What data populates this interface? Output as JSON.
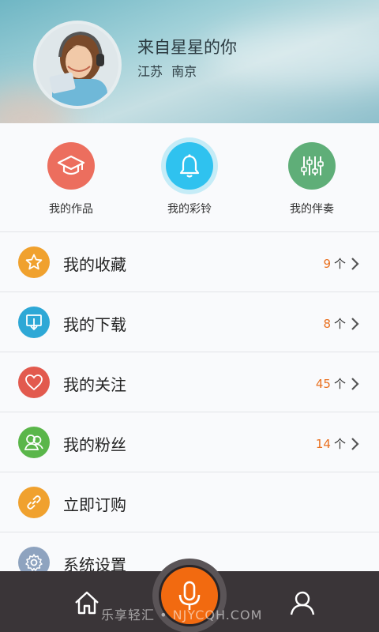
{
  "profile": {
    "nickname": "来自星星的你",
    "location": "江苏 南京"
  },
  "quick_actions": [
    {
      "label": "我的作品",
      "icon": "graduation-cap-icon",
      "color": "#ec6e5e"
    },
    {
      "label": "我的彩铃",
      "icon": "bell-icon",
      "color": "#2fc2ef"
    },
    {
      "label": "我的伴奏",
      "icon": "equalizer-icon",
      "color": "#5fae78"
    }
  ],
  "menu": [
    {
      "label": "我的收藏",
      "icon": "star-icon",
      "color": "#f0a12e",
      "count": "9",
      "unit": "个"
    },
    {
      "label": "我的下载",
      "icon": "download-icon",
      "color": "#2ea8d6",
      "count": "8",
      "unit": "个"
    },
    {
      "label": "我的关注",
      "icon": "heart-icon",
      "color": "#e25a4e",
      "count": "45",
      "unit": "个"
    },
    {
      "label": "我的粉丝",
      "icon": "fans-icon",
      "color": "#5ab64a",
      "count": "14",
      "unit": "个"
    },
    {
      "label": "立即订购",
      "icon": "link-icon",
      "color": "#f0a12e"
    },
    {
      "label": "系统设置",
      "icon": "gear-icon",
      "color": "#8ea3bf"
    }
  ],
  "bottom_nav": {
    "home_icon": "home-icon",
    "record_icon": "microphone-icon",
    "profile_icon": "user-icon",
    "accent": "#f26a10"
  },
  "watermark": "乐享轻汇 • NJYCQH.COM"
}
